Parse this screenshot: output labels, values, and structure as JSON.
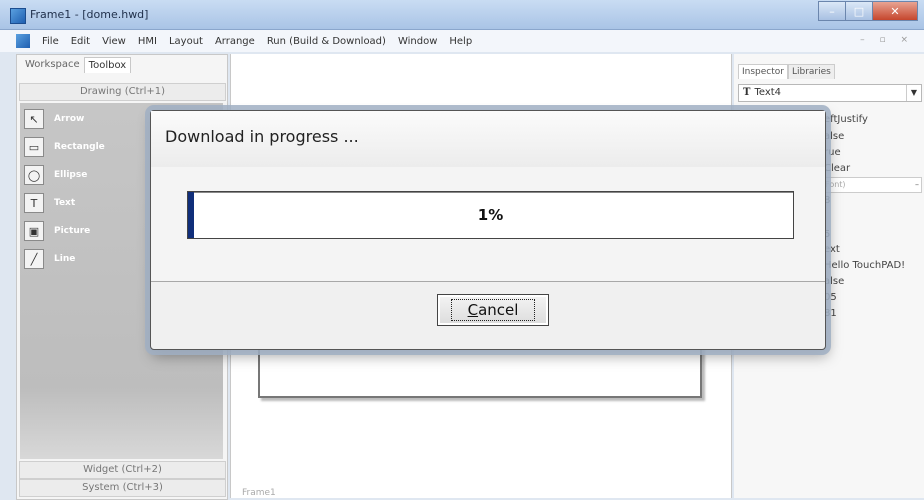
{
  "window": {
    "title": "Frame1 - [dome.hwd]",
    "buttons": [
      "–",
      "□",
      "✕"
    ]
  },
  "menubar": {
    "items": [
      "File",
      "Edit",
      "View",
      "HMI",
      "Layout",
      "Arrange",
      "Run (Build & Download)",
      "Window",
      "Help"
    ],
    "mdi_controls": "– ▫ ×"
  },
  "left_panel": {
    "tabs": [
      "Workspace",
      "Toolbox"
    ],
    "active_tab": "Toolbox",
    "sections": [
      "Drawing (Ctrl+1)",
      "Widget (Ctrl+2)",
      "System (Ctrl+3)"
    ],
    "tools": [
      {
        "label": "Arrow",
        "icon": "arrow-icon"
      },
      {
        "label": "Rectangle",
        "icon": "rectangle-icon"
      },
      {
        "label": "Ellipse",
        "icon": "ellipse-icon"
      },
      {
        "label": "Text",
        "icon": "text-icon"
      },
      {
        "label": "Picture",
        "icon": "picture-icon"
      },
      {
        "label": "Line",
        "icon": "line-icon"
      }
    ]
  },
  "canvas": {
    "frame_label": "Frame1"
  },
  "right_panel": {
    "tabs": [
      "Inspector",
      "Libraries"
    ],
    "selected_object": "Text4",
    "properties": [
      "eftJustify",
      "alse",
      "rue",
      "Clear",
      "Font)",
      "8",
      "",
      "5",
      "ext",
      "Hello TouchPAD!",
      "alse",
      "05",
      "81"
    ]
  },
  "dialog": {
    "title": "Download in progress ...",
    "progress_percent": 1,
    "progress_text": "1%",
    "cancel_first": "C",
    "cancel_rest": "ancel"
  },
  "colors": {
    "progress_fill": "#102e7a",
    "tool_bg": "#c3c3c3"
  }
}
